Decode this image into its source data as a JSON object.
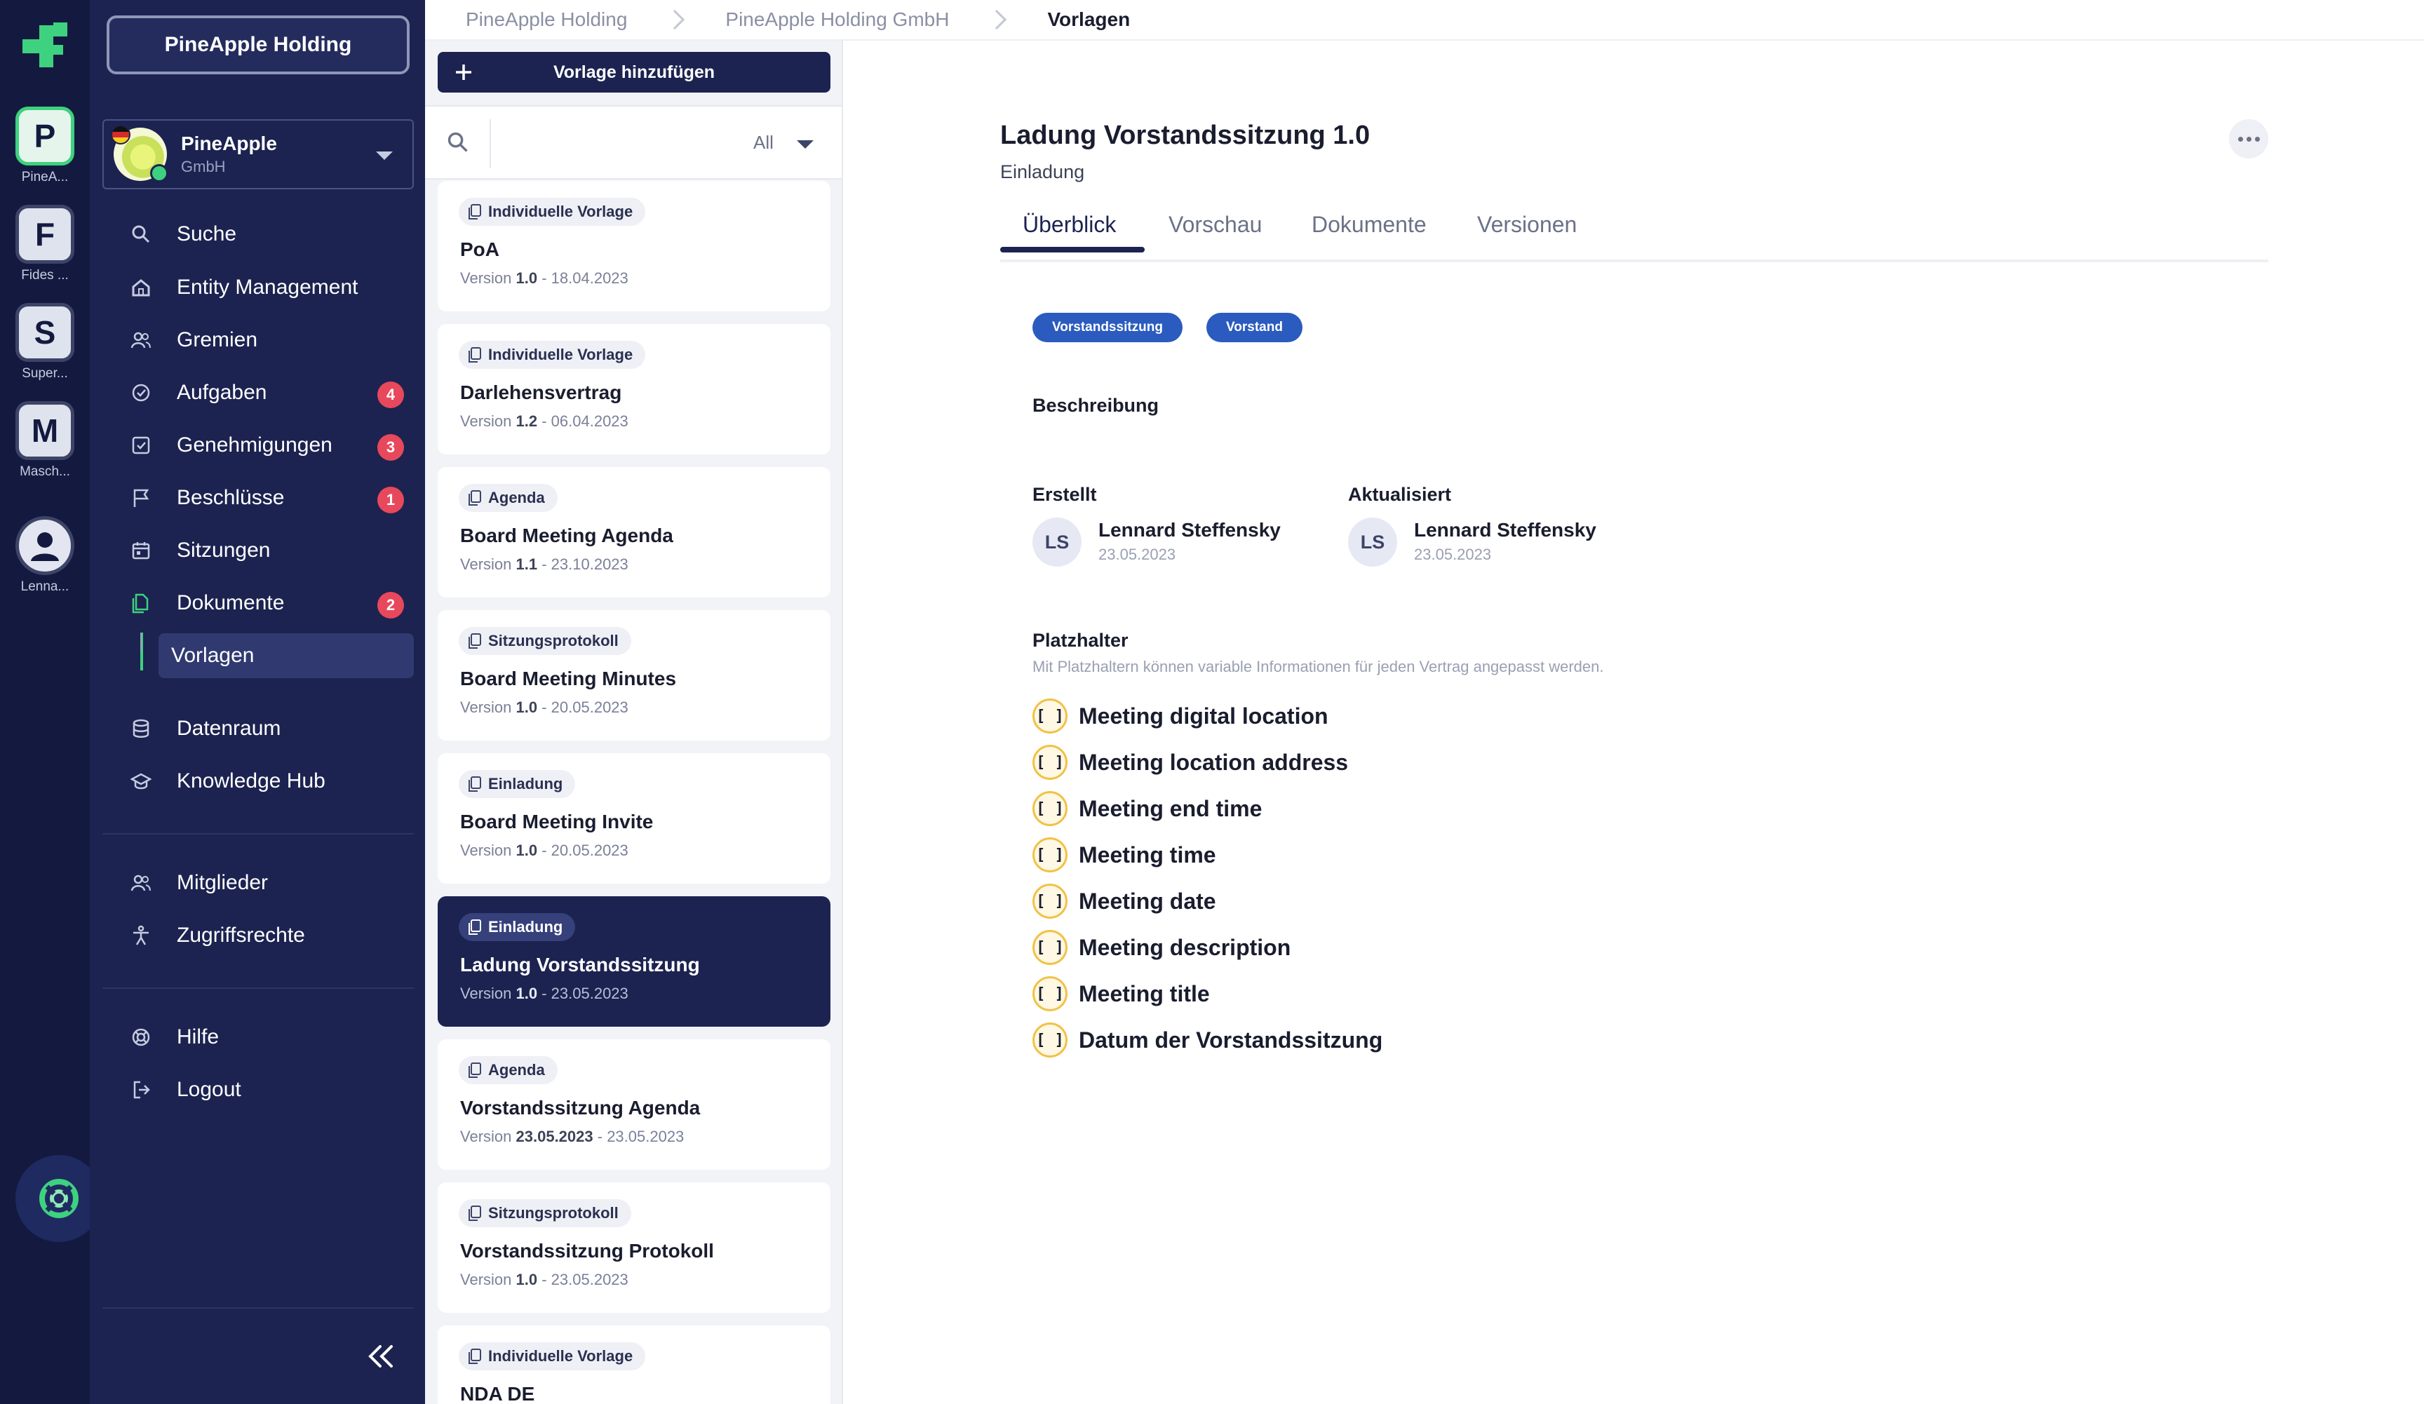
{
  "workspaces": [
    {
      "letter": "P",
      "name": "PineA...",
      "active": true
    },
    {
      "letter": "F",
      "name": "Fides ...",
      "active": false
    },
    {
      "letter": "S",
      "name": "Super...",
      "active": false
    },
    {
      "letter": "M",
      "name": "Masch...",
      "active": false
    }
  ],
  "user_workspace_name": "Lenna...",
  "sidebar": {
    "org_button": "PineApple Holding",
    "entity": {
      "name": "PineApple",
      "sub": "GmbH"
    },
    "items": [
      {
        "label": "Suche",
        "icon": "search-icon"
      },
      {
        "label": "Entity Management",
        "icon": "home-icon"
      },
      {
        "label": "Gremien",
        "icon": "users-icon"
      },
      {
        "label": "Aufgaben",
        "icon": "check-circle-icon",
        "badge": "4"
      },
      {
        "label": "Genehmigungen",
        "icon": "check-square-icon",
        "badge": "3"
      },
      {
        "label": "Beschlüsse",
        "icon": "flag-icon",
        "badge": "1"
      },
      {
        "label": "Sitzungen",
        "icon": "calendar-icon"
      },
      {
        "label": "Dokumente",
        "icon": "documents-icon",
        "badge": "2"
      },
      {
        "label": "Vorlagen",
        "icon": "none"
      },
      {
        "label": "Datenraum",
        "icon": "database-icon"
      },
      {
        "label": "Knowledge Hub",
        "icon": "graduation-icon"
      },
      {
        "label": "Mitglieder",
        "icon": "users-icon"
      },
      {
        "label": "Zugriffsrechte",
        "icon": "accessibility-icon"
      },
      {
        "label": "Hilfe",
        "icon": "lifebuoy-icon"
      },
      {
        "label": "Logout",
        "icon": "logout-icon"
      }
    ]
  },
  "breadcrumb": [
    "PineApple Holding",
    "PineApple Holding GmbH",
    "Vorlagen"
  ],
  "list": {
    "add_button": "Vorlage hinzufügen",
    "search_placeholder": "",
    "filter": "All",
    "version_prefix": "Version",
    "templates": [
      {
        "tag": "Individuelle Vorlage",
        "title": "PoA",
        "version": "1.0",
        "date": "18.04.2023"
      },
      {
        "tag": "Individuelle Vorlage",
        "title": "Darlehensvertrag",
        "version": "1.2",
        "date": "06.04.2023"
      },
      {
        "tag": "Agenda",
        "title": "Board Meeting Agenda",
        "version": "1.1",
        "date": "23.10.2023"
      },
      {
        "tag": "Sitzungsprotokoll",
        "title": "Board Meeting Minutes",
        "version": "1.0",
        "date": "20.05.2023"
      },
      {
        "tag": "Einladung",
        "title": "Board Meeting Invite",
        "version": "1.0",
        "date": "20.05.2023"
      },
      {
        "tag": "Einladung",
        "title": "Ladung Vorstandssitzung",
        "version": "1.0",
        "date": "23.05.2023",
        "selected": true
      },
      {
        "tag": "Agenda",
        "title": "Vorstandssitzung Agenda",
        "version": "23.05.2023",
        "date": "23.05.2023"
      },
      {
        "tag": "Sitzungsprotokoll",
        "title": "Vorstandssitzung Protokoll",
        "version": "1.0",
        "date": "23.05.2023"
      },
      {
        "tag": "Individuelle Vorlage",
        "title": "NDA DE",
        "version": "",
        "date": ""
      }
    ]
  },
  "detail": {
    "title": "Ladung Vorstandssitzung 1.0",
    "subtitle": "Einladung",
    "tabs": [
      "Überblick",
      "Vorschau",
      "Dokumente",
      "Versionen"
    ],
    "chips": [
      "Vorstandssitzung",
      "Vorstand"
    ],
    "description_label": "Beschreibung",
    "created_label": "Erstellt",
    "updated_label": "Aktualisiert",
    "created": {
      "initials": "LS",
      "name": "Lennard Steffensky",
      "date": "23.05.2023"
    },
    "updated": {
      "initials": "LS",
      "name": "Lennard Steffensky",
      "date": "23.05.2023"
    },
    "placeholders_label": "Platzhalter",
    "placeholders_hint": "Mit Platzhaltern können variable Informationen für jeden Vertrag angepasst werden.",
    "placeholder_icon": "[ ]",
    "placeholders": [
      "Meeting digital location",
      "Meeting location address",
      "Meeting end time",
      "Meeting time",
      "Meeting date",
      "Meeting description",
      "Meeting title",
      "Datum der Vorstandssitzung"
    ]
  },
  "colors": {
    "navy": "#1c2350",
    "rail": "#141a3f",
    "accent": "#3ed17f",
    "badge": "#e8485b",
    "chip": "#2b5bbf",
    "placeholder_ring": "#f1c247"
  }
}
